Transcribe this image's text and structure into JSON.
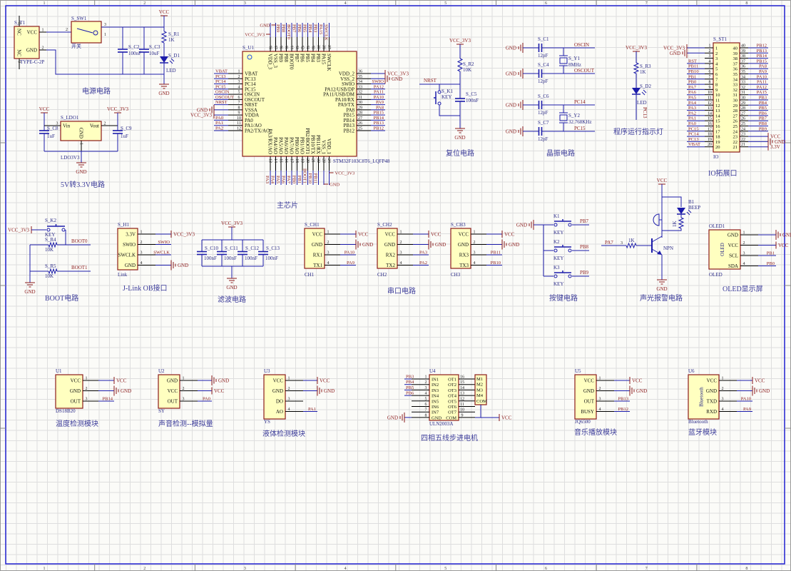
{
  "frame": {
    "columns": [
      "1",
      "2",
      "3",
      "4",
      "5",
      "6",
      "7",
      "8"
    ]
  },
  "colors": {
    "wire": "#1c1caa",
    "part": "#8b1a1a",
    "fill": "#ffffc0",
    "label": "#2a2a88",
    "title": "#3c3c9a",
    "frame": "#2020d0"
  },
  "power": {
    "vcc": "VCC",
    "vcc33": "VCC_3V3",
    "gnd": "GND",
    "v33": "3.3V"
  },
  "titles": {
    "power": "电源电路",
    "ldo": "5V转3.3V电路",
    "mcu": "主芯片",
    "reset": "复位电路",
    "crystal": "晶振电路",
    "run_led": "程序运行指示灯",
    "io": "IO拓展口",
    "boot": "BOOT电路",
    "jlink": "J-Link OB接口",
    "filter": "滤波电路",
    "serial": "串口电路",
    "keys": "按键电路",
    "alarm": "声光报警电路",
    "oled": "OLED显示屏",
    "temp": "温度检测模块",
    "sound": "声音检测--模拟量",
    "liquid": "液体检测模块",
    "stepper": "四相五线步进电机",
    "music": "音乐播放模块",
    "bt": "蓝牙模块"
  },
  "nets": {
    "oscin": "OSCIN",
    "oscout": "OSCOUT",
    "pc14": "PC14",
    "pc15": "PC15",
    "pc13": "PC13",
    "nrst": "NRST",
    "boot0": "BOOT0",
    "boot1": "BOOT1",
    "pb7": "PB7",
    "pb8": "PB8",
    "pb9": "PB9",
    "pa7": "PA7"
  },
  "ics": {
    "mcu": {
      "ref": "S_U1",
      "part": "STM32F103C8T6_LQFP48",
      "left": [
        [
          "1",
          "VBAT",
          "VBAT"
        ],
        [
          "2",
          "PC13",
          "PC13"
        ],
        [
          "3",
          "PC14",
          "PC14"
        ],
        [
          "4",
          "PC15",
          "PC15"
        ],
        [
          "5",
          "OSCIN",
          "OSCIN"
        ],
        [
          "6",
          "OSCOUT",
          "OSCOUT"
        ],
        [
          "7",
          "NRST",
          "NRST"
        ],
        [
          "8",
          "VSSA",
          "GND"
        ],
        [
          "9",
          "VDDA",
          "VCC_3V3"
        ],
        [
          "10",
          "PA0",
          "PA0"
        ],
        [
          "11",
          "PA1/AO",
          "PA1"
        ],
        [
          "12",
          "PA2/TX/AO",
          "PA2"
        ]
      ],
      "right": [
        [
          "36",
          "VDD_2",
          "VCC_3V3"
        ],
        [
          "35",
          "VSS_2",
          "GND"
        ],
        [
          "34",
          "SWIO",
          "SWIO"
        ],
        [
          "33",
          "PA12/USB/DP",
          "PA12"
        ],
        [
          "32",
          "PA11/USB/DM",
          "PA11"
        ],
        [
          "31",
          "PA10/RX",
          "PA10"
        ],
        [
          "30",
          "PA9/TX",
          "PA9"
        ],
        [
          "29",
          "PA8",
          "PA8"
        ],
        [
          "28",
          "PB15",
          "PB15"
        ],
        [
          "27",
          "PB14",
          "PB14"
        ],
        [
          "26",
          "PB13",
          "PB13"
        ],
        [
          "25",
          "PB12",
          "PB12"
        ]
      ],
      "top": [
        [
          "48",
          "VDD_3",
          "VCC_3V3"
        ],
        [
          "47",
          "VSS_3",
          "GND"
        ],
        [
          "46",
          "PB9",
          "PB9"
        ],
        [
          "45",
          "PB8",
          "PB8"
        ],
        [
          "44",
          "BOOT0",
          "BOOT0"
        ],
        [
          "43",
          "PB7",
          "PB7"
        ],
        [
          "42",
          "PB6",
          "PB6"
        ],
        [
          "41",
          "PB5",
          "PB5"
        ],
        [
          "40",
          "PB4",
          "PB4"
        ],
        [
          "39",
          "PB3",
          "PB3"
        ],
        [
          "38",
          "PA15",
          "PA15"
        ],
        [
          "37",
          "SWCLK",
          "SWCLK"
        ]
      ],
      "bottom": [
        [
          "13",
          "PA3/RX/AO",
          "PA3"
        ],
        [
          "14",
          "PA4/AO",
          "PA4"
        ],
        [
          "15",
          "PA5/AO",
          "PA5"
        ],
        [
          "16",
          "PA6/AO",
          "PA6"
        ],
        [
          "17",
          "PA7/AO",
          "PA7"
        ],
        [
          "18",
          "PB0/AO",
          "PB0"
        ],
        [
          "19",
          "PB1/AO",
          "PB1"
        ],
        [
          "20",
          "PB2/BOOT1",
          "BOOT1"
        ],
        [
          "21",
          "PB10/TX",
          "PB10"
        ],
        [
          "22",
          "PB11/RX",
          "PB11"
        ],
        [
          "23",
          "VSS_1",
          "GND"
        ],
        [
          "24",
          "VDD_1",
          "VCC_3V3"
        ]
      ]
    },
    "io": {
      "ref": "S_ST1",
      "part": "IO",
      "left": [
        [
          "1",
          "1",
          "VCC_3V3"
        ],
        [
          "2",
          "2",
          "GND"
        ],
        [
          "3",
          "3",
          ""
        ],
        [
          "4",
          "4",
          "RST"
        ],
        [
          "5",
          "5",
          "PB11"
        ],
        [
          "6",
          "6",
          "PB10"
        ],
        [
          "7",
          "7",
          "PB1"
        ],
        [
          "8",
          "8",
          "PB0"
        ],
        [
          "9",
          "9",
          "PA7"
        ],
        [
          "10",
          "10",
          "PA6"
        ],
        [
          "11",
          "11",
          "PA5"
        ],
        [
          "12",
          "12",
          "PA4"
        ],
        [
          "13",
          "13",
          "PA3"
        ],
        [
          "14",
          "14",
          "PA2"
        ],
        [
          "15",
          "15",
          "PA1"
        ],
        [
          "16",
          "16",
          "PA0"
        ],
        [
          "17",
          "17",
          "PC15"
        ],
        [
          "18",
          "18",
          "PC14"
        ],
        [
          "19",
          "19",
          "PC13"
        ],
        [
          "20",
          "20",
          "VBAT"
        ]
      ],
      "right": [
        [
          "40",
          "40",
          "PB12"
        ],
        [
          "39",
          "39",
          "PB13"
        ],
        [
          "38",
          "38",
          "PB14"
        ],
        [
          "37",
          "37",
          "PB15"
        ],
        [
          "36",
          "36",
          "PA8"
        ],
        [
          "35",
          "35",
          "PA9"
        ],
        [
          "34",
          "34",
          "PA10"
        ],
        [
          "33",
          "33",
          "PA11"
        ],
        [
          "32",
          "32",
          "PA12"
        ],
        [
          "31",
          "31",
          "PA15"
        ],
        [
          "30",
          "30",
          "PB3"
        ],
        [
          "29",
          "29",
          "PB4"
        ],
        [
          "28",
          "28",
          "PB5"
        ],
        [
          "27",
          "27",
          "PB6"
        ],
        [
          "26",
          "26",
          "PB7"
        ],
        [
          "25",
          "25",
          "PB8"
        ],
        [
          "24",
          "24",
          "PB9"
        ],
        [
          "23",
          "23",
          "VCC"
        ],
        [
          "22",
          "22",
          "GND"
        ],
        [
          "21",
          "21",
          "3.3V"
        ]
      ]
    },
    "typec": {
      "ref": "S_T1",
      "part": "TYPE-C-2P",
      "top": [
        [
          "0",
          "NC",
          ""
        ]
      ],
      "bottom": [
        [
          "0",
          "NC",
          ""
        ]
      ],
      "right": [
        [
          "1",
          "VCC",
          ""
        ],
        [
          "2",
          "GND",
          ""
        ]
      ]
    },
    "ldo": {
      "ref": "S_LDO1",
      "part": "LDO3V3",
      "left": [
        [
          "3",
          "Vin",
          ""
        ]
      ],
      "right": [
        [
          "2",
          "Vout",
          ""
        ]
      ],
      "bottom": [
        [
          "1",
          "GND",
          ""
        ]
      ]
    },
    "h1": {
      "ref": "S_H1",
      "part": "Link",
      "right": [
        [
          "1",
          "3.3V",
          "VCC_3V3"
        ],
        [
          "2",
          "SWIO",
          "SWIO"
        ],
        [
          "3",
          "SWCLK",
          "SWCLK"
        ],
        [
          "4",
          "GND",
          "GND"
        ]
      ]
    },
    "ch1": {
      "ref": "S_CH1",
      "part": "CH1",
      "right": [
        [
          "1",
          "VCC",
          "VCC"
        ],
        [
          "2",
          "GND",
          "GND"
        ],
        [
          "3",
          "RX1",
          "PA10"
        ],
        [
          "4",
          "TX1",
          "PA9"
        ]
      ]
    },
    "ch2": {
      "ref": "S_CH2",
      "part": "CH2",
      "right": [
        [
          "1",
          "VCC",
          "VCC"
        ],
        [
          "2",
          "GND",
          "GND"
        ],
        [
          "3",
          "RX2",
          "PA3"
        ],
        [
          "4",
          "TX2",
          "PA2"
        ]
      ]
    },
    "ch3": {
      "ref": "S_CH3",
      "part": "CH3",
      "right": [
        [
          "1",
          "VCC",
          "VCC"
        ],
        [
          "2",
          "GND",
          "GND"
        ],
        [
          "3",
          "RX3",
          "PB11"
        ],
        [
          "4",
          "TX3",
          "PB10"
        ]
      ]
    },
    "oled": {
      "ref": "OLED1",
      "part": "OLED",
      "inner": "OLED",
      "right": [
        [
          "1",
          "GND",
          "GND"
        ],
        [
          "2",
          "VCC",
          "VCC"
        ],
        [
          "3",
          "SCL",
          "PB1"
        ],
        [
          "4",
          "SDA",
          "PB0"
        ]
      ]
    },
    "u1": {
      "ref": "U1",
      "part": "DS18B20",
      "right": [
        [
          "1",
          "VCC",
          "VCC"
        ],
        [
          "2",
          "GND",
          "GND"
        ],
        [
          "3",
          "OUT",
          "PB14"
        ]
      ]
    },
    "u2": {
      "ref": "U2",
      "part": "SY",
      "right": [
        [
          "1",
          "GND",
          "GND"
        ],
        [
          "2",
          "VCC",
          "VCC"
        ],
        [
          "3",
          "OUT",
          "PA0"
        ]
      ]
    },
    "u3": {
      "ref": "U3",
      "part": "YS",
      "right": [
        [
          "1",
          "VCC",
          "VCC"
        ],
        [
          "2",
          "GND",
          "GND"
        ],
        [
          "3",
          "DO",
          ""
        ],
        [
          "4",
          "AO",
          "PA1"
        ]
      ]
    },
    "u4": {
      "ref": "U4",
      "part": "ULN2003A",
      "left": [
        [
          "1",
          "IN1",
          "PB3"
        ],
        [
          "2",
          "IN2",
          "PB4"
        ],
        [
          "3",
          "IN3",
          "PB5"
        ],
        [
          "4",
          "IN4",
          "PB6"
        ],
        [
          "5",
          "IN5",
          ""
        ],
        [
          "6",
          "IN6",
          ""
        ],
        [
          "7",
          "IN7",
          ""
        ],
        [
          "8",
          "GND",
          "GND"
        ]
      ],
      "right": [
        [
          "16",
          "OT1",
          ""
        ],
        [
          "15",
          "OT2",
          ""
        ],
        [
          "14",
          "OT3",
          ""
        ],
        [
          "13",
          "OT4",
          ""
        ],
        [
          "12",
          "OT5",
          ""
        ],
        [
          "11",
          "OT6",
          ""
        ],
        [
          "10",
          "OT7",
          ""
        ],
        [
          "9",
          "COM",
          ""
        ]
      ]
    },
    "motor": {
      "ref": "",
      "part": "",
      "left": [
        [
          "",
          "M1",
          ""
        ],
        [
          "",
          "M2",
          ""
        ],
        [
          "",
          "M3",
          ""
        ],
        [
          "",
          "M4",
          ""
        ],
        [
          "",
          "COM",
          ""
        ]
      ]
    },
    "u5": {
      "ref": "U5",
      "part": "JQ6500",
      "right": [
        [
          "1",
          "VCC",
          "VCC"
        ],
        [
          "2",
          "GND",
          "GND"
        ],
        [
          "3",
          "OUT",
          "PB13"
        ],
        [
          "4",
          "BUSY",
          "PB12"
        ]
      ]
    },
    "u6": {
      "ref": "U6",
      "part": "Bluetooth",
      "inner": "Bluetooth",
      "right": [
        [
          "1",
          "VCC",
          "VCC"
        ],
        [
          "2",
          "GND",
          "GND"
        ],
        [
          "3",
          "TXD",
          "PA10"
        ],
        [
          "4",
          "RXD",
          "PA9"
        ]
      ]
    }
  },
  "discretes": {
    "sw1": {
      "ref": "S_SW1",
      "value": "开关",
      "pins": [
        "2",
        "3",
        "1"
      ]
    },
    "r1": {
      "ref": "S_R1",
      "value": "1K"
    },
    "c2": {
      "ref": "S_C2",
      "value": "100nF"
    },
    "c3": {
      "ref": "S_C3",
      "value": "10uF"
    },
    "d1": {
      "ref": "S_D1",
      "value": "LED"
    },
    "c8": {
      "ref": "S_C8",
      "value": "1uF"
    },
    "c9": {
      "ref": "S_C9",
      "value": "1uF"
    },
    "r2": {
      "ref": "S_R2",
      "value": "10K"
    },
    "k1": {
      "ref": "S_K1",
      "value": "KEY"
    },
    "c5": {
      "ref": "S_C5",
      "value": "100nF"
    },
    "c1": {
      "ref": "S_C1",
      "value": "12pF"
    },
    "c4": {
      "ref": "S_C4",
      "value": "12pF"
    },
    "c6": {
      "ref": "S_C6",
      "value": "12pF"
    },
    "c7": {
      "ref": "S_C7",
      "value": "12pF"
    },
    "y1": {
      "ref": "S_Y1",
      "value": "8MHz"
    },
    "y2": {
      "ref": "S_Y2",
      "value": "32.768KHz"
    },
    "r3": {
      "ref": "S_R3",
      "value": "1K"
    },
    "d2": {
      "ref": "S_D2",
      "value": "LED"
    },
    "k2": {
      "ref": "S_K2",
      "value": "KEY"
    },
    "r4": {
      "ref": "S_R4",
      "value": "10K"
    },
    "r5": {
      "ref": "S_R5",
      "value": "10K"
    },
    "c10": {
      "ref": "S_C10",
      "value": "100nF"
    },
    "c11": {
      "ref": "S_C11",
      "value": "100nF"
    },
    "c12": {
      "ref": "S_C12",
      "value": "100nF"
    },
    "c13": {
      "ref": "S_C13",
      "value": "100nF"
    },
    "key1": {
      "ref": "K1",
      "value": "KEY"
    },
    "key2": {
      "ref": "K2",
      "value": "KEY"
    },
    "key3": {
      "ref": "K3",
      "value": "KEY"
    },
    "b1": {
      "ref": "B1",
      "value": "BEEP"
    },
    "rb": {
      "value": "1K"
    },
    "rq": {
      "value": "1K",
      "pin": "3"
    },
    "q1": {
      "value": "NPN"
    }
  }
}
